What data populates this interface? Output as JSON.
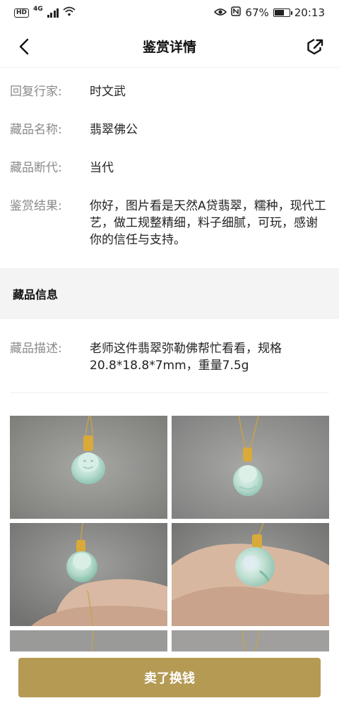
{
  "status_bar": {
    "hd": "HD",
    "network": "4G",
    "battery_percent": "67%",
    "battery_level": 0.67,
    "time": "20:13"
  },
  "nav": {
    "title": "鉴赏详情",
    "back_icon": "chevron-left-icon",
    "share_icon": "share-icon"
  },
  "appraisal": {
    "expert_label": "回复行家:",
    "expert_value": "时文武",
    "name_label": "藏品名称:",
    "name_value": "翡翠佛公",
    "era_label": "藏品断代:",
    "era_value": "当代",
    "result_label": "鉴赏结果:",
    "result_value": "你好，图片看是天然A贷翡翠，糯种，现代工艺，做工规整精细，料子细腻，可玩，感谢你的信任与支持。"
  },
  "item_info": {
    "section_title": "藏品信息",
    "desc_label": "藏品描述:",
    "desc_value": "老师这件翡翠弥勒佛帮忙看看，规格20.8*18.8*7mm，重量7.5g"
  },
  "bottom": {
    "sell_button": "卖了换钱"
  },
  "colors": {
    "accent": "#b59a54",
    "label_gray": "#8a8a8a",
    "section_bg": "#f4f4f4"
  }
}
